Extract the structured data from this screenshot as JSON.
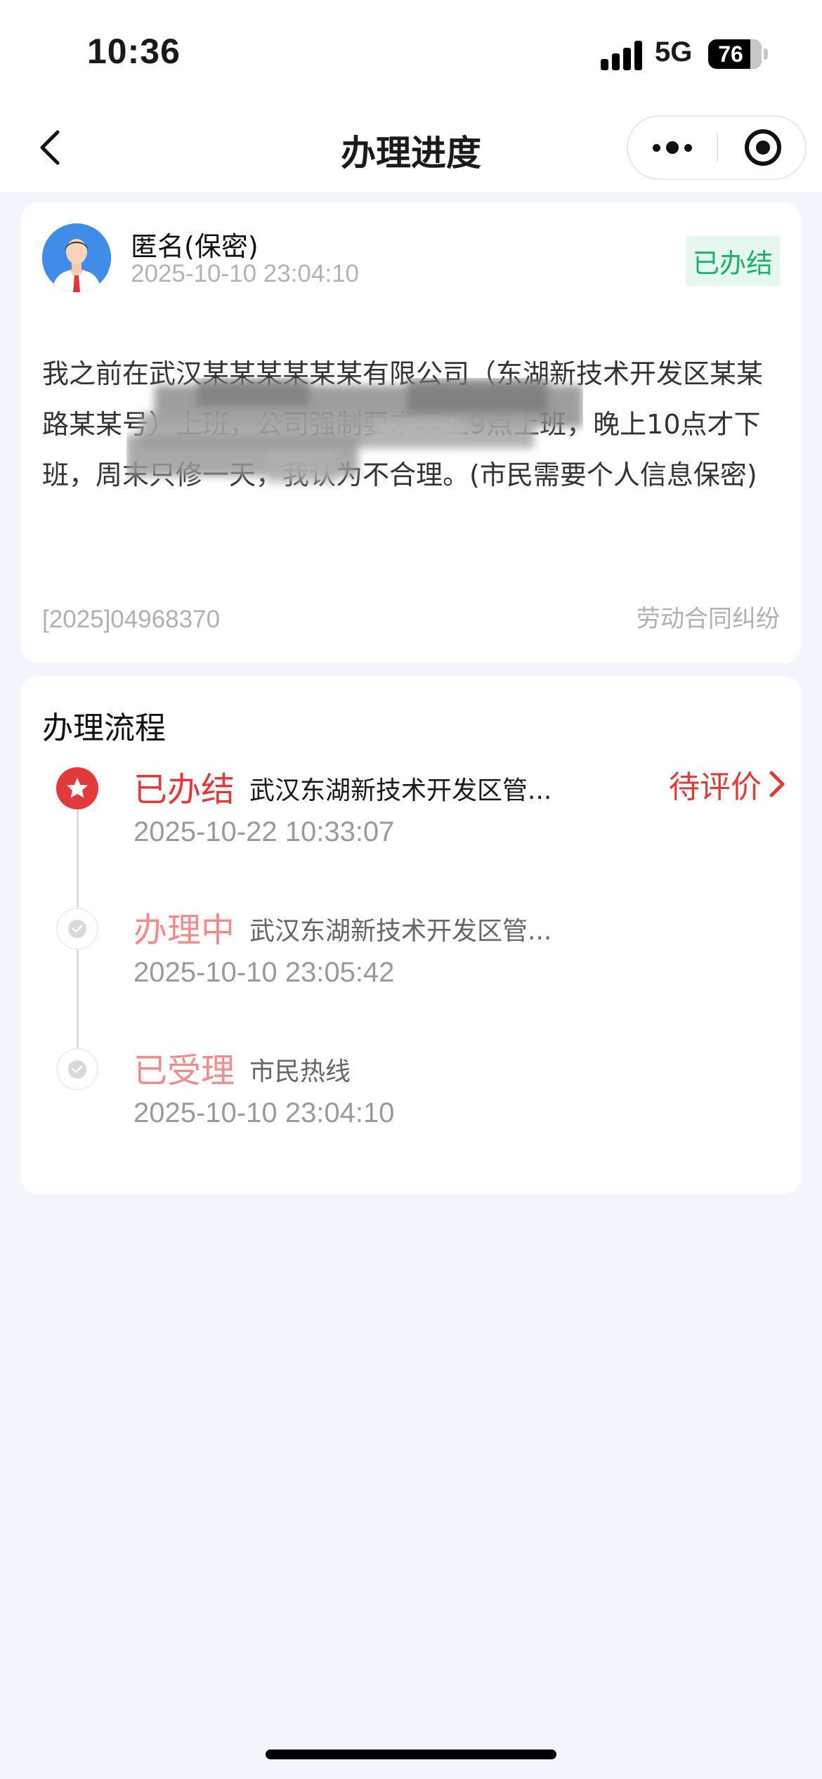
{
  "status_bar": {
    "time": "10:36",
    "network": "5G",
    "battery": "76"
  },
  "navbar": {
    "title": "办理进度"
  },
  "ticket": {
    "name": "匿名(保密)",
    "submit_time": "2025-10-10 23:04:10",
    "status": "已办结",
    "content": "我之前在武汉某某某某某某有限公司（东湖新技术开发区某某路某某号）上班，公司强制要求早上9点上班，晚上10点才下班，周末只修一天，我认为不合理。(市民需要个人信息保密)",
    "ticket_no": "[2025]04968370",
    "category": "劳动合同纠纷"
  },
  "flow": {
    "title": "办理流程",
    "rate_label": "待评价",
    "steps": [
      {
        "status": "已办结",
        "dept": "武汉东湖新技术开发区管...",
        "time": "2025-10-22 10:33:07"
      },
      {
        "status": "办理中",
        "dept": "武汉东湖新技术开发区管...",
        "time": "2025-10-10 23:05:42"
      },
      {
        "status": "已受理",
        "dept": "市民热线",
        "time": "2025-10-10 23:04:10"
      }
    ]
  },
  "colors": {
    "accent_red": "#e23a3a",
    "done_green": "#17b567",
    "page_bg": "#f2f5fb"
  }
}
